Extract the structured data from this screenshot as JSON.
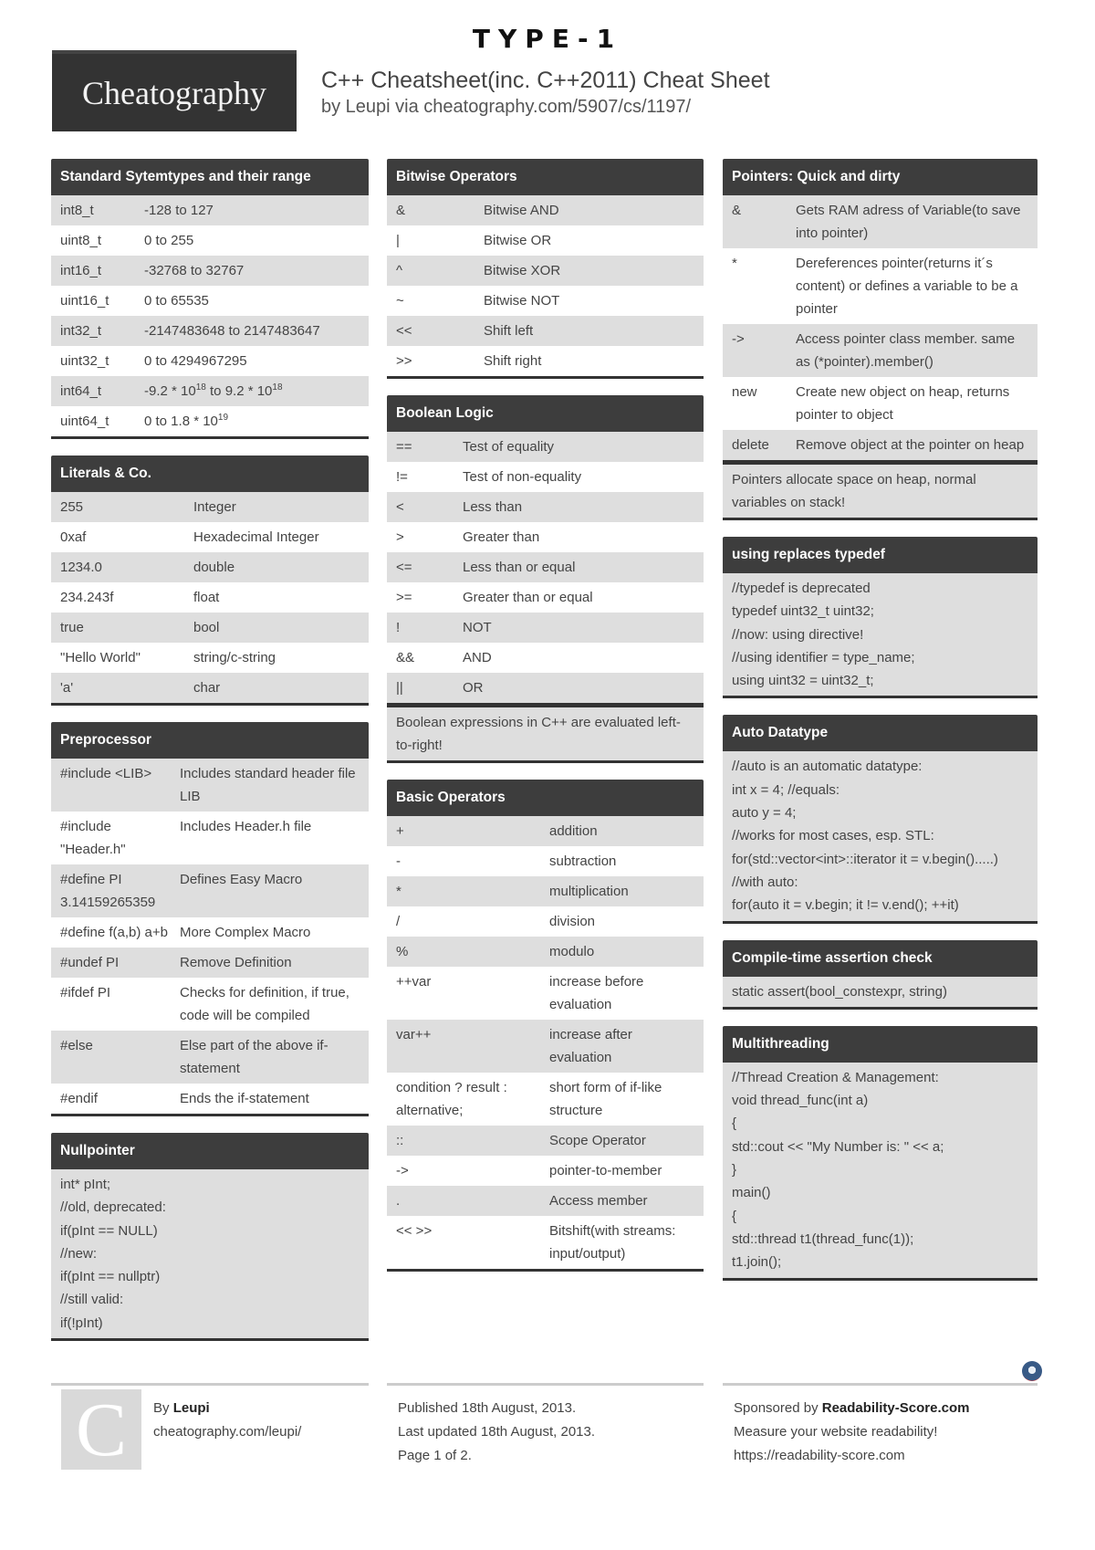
{
  "header": {
    "type_label": "TYPE-1",
    "logo_text": "Cheatography",
    "title": "C++ Cheatsheet(inc. C++2011) Cheat Sheet",
    "byline": "by Leupi via cheatography.com/5907/cs/1197/"
  },
  "sections": {
    "systemtypes": {
      "title": "Standard Sytemtypes and their range",
      "rows": [
        {
          "k": "int8_t",
          "v": "-128 to 127"
        },
        {
          "k": "uint8_t",
          "v": "0 to 255"
        },
        {
          "k": "int16_t",
          "v": "-32768 to 32767"
        },
        {
          "k": "uint16_t",
          "v": "0 to 65535"
        },
        {
          "k": "int32_t",
          "v": "-2147483648 to 2147483647"
        },
        {
          "k": "uint32_t",
          "v": "0 to 4294967295"
        },
        {
          "k": "int64_t",
          "v": "-9.2 * 10",
          "sup1": "18",
          "mid": " to 9.2 * 10",
          "sup2": "18"
        },
        {
          "k": "uint64_t",
          "v": "0 to 1.8 * 10",
          "sup1": "19"
        }
      ]
    },
    "literals": {
      "title": "Literals & Co.",
      "rows": [
        {
          "k": "255",
          "v": "Integer"
        },
        {
          "k": "0xaf",
          "v": "Hexadecimal Integer"
        },
        {
          "k": "1234.0",
          "v": "double"
        },
        {
          "k": "234.243f",
          "v": "float"
        },
        {
          "k": "true",
          "v": "bool"
        },
        {
          "k": "\"Hello World\"",
          "v": "string/c-string"
        },
        {
          "k": "'a'",
          "v": "char"
        }
      ]
    },
    "preprocessor": {
      "title": "Preprocessor",
      "rows": [
        {
          "k": "#include <LIB>",
          "v": "Includes standard header file LIB"
        },
        {
          "k": "#include \"Header.h\"",
          "v": "Includes Header.h file"
        },
        {
          "k": "#define PI 3.14159265359",
          "v": "Defines Easy Macro"
        },
        {
          "k": "#define f(a,b) a+b",
          "v": "More Complex Macro"
        },
        {
          "k": "#undef PI",
          "v": "Remove Definition"
        },
        {
          "k": "#ifdef PI",
          "v": "Checks for definition, if true, code will be compiled"
        },
        {
          "k": "#else",
          "v": "Else part of the above if-statement"
        },
        {
          "k": "#endif",
          "v": "Ends the if-statement"
        }
      ]
    },
    "nullpointer": {
      "title": "Nullpointer",
      "lines": [
        "int* pInt;",
        "//old, deprecated:",
        "if(pInt == NULL)",
        "//new:",
        "if(pInt == nullptr)",
        "//still valid:",
        "if(!pInt)"
      ]
    },
    "bitwise": {
      "title": "Bitwise Operators",
      "rows": [
        {
          "k": "&",
          "v": "Bitwise AND"
        },
        {
          "k": "|",
          "v": "Bitwise OR"
        },
        {
          "k": "^",
          "v": "Bitwise XOR"
        },
        {
          "k": "~",
          "v": "Bitwise NOT"
        },
        {
          "k": "<<",
          "v": "Shift left"
        },
        {
          "k": ">>",
          "v": "Shift right"
        }
      ]
    },
    "boolean": {
      "title": "Boolean Logic",
      "rows": [
        {
          "k": "==",
          "v": "Test of equality"
        },
        {
          "k": "!=",
          "v": "Test of non-equality"
        },
        {
          "k": "<",
          "v": "Less than"
        },
        {
          "k": ">",
          "v": "Greater than"
        },
        {
          "k": "<=",
          "v": "Less than or equal"
        },
        {
          "k": ">=",
          "v": "Greater than or equal"
        },
        {
          "k": "!",
          "v": "NOT"
        },
        {
          "k": "&&",
          "v": "AND"
        },
        {
          "k": "||",
          "v": "OR"
        }
      ],
      "note": "Boolean expressions in C++ are evaluated left-to-right!"
    },
    "basic": {
      "title": "Basic Operators",
      "rows": [
        {
          "k": "+",
          "v": "addition"
        },
        {
          "k": "-",
          "v": "subtraction"
        },
        {
          "k": "*",
          "v": "multiplication"
        },
        {
          "k": "/",
          "v": "division"
        },
        {
          "k": "%",
          "v": "modulo"
        },
        {
          "k": "++var",
          "v": "increase before evaluation"
        },
        {
          "k": "var++",
          "v": "increase after evaluation"
        },
        {
          "k": "condition ? result : alternative;",
          "v": "short form of if-like structure"
        },
        {
          "k": "::",
          "v": "Scope Operator"
        },
        {
          "k": "->",
          "v": "pointer-to-member"
        },
        {
          "k": ".",
          "v": "Access member"
        },
        {
          "k": "<< >>",
          "v": "Bitshift(with streams: input/output)"
        }
      ]
    },
    "pointers": {
      "title": "Pointers: Quick and dirty",
      "rows": [
        {
          "k": "&",
          "v": "Gets RAM adress of Variable(to save into pointer)"
        },
        {
          "k": "*",
          "v": "Dereferences pointer(returns it´s content) or defines a variable to be a pointer"
        },
        {
          "k": "->",
          "v": "Access pointer class member. same as (*pointer).member()"
        },
        {
          "k": "new",
          "v": "Create new object on heap, returns pointer to object"
        },
        {
          "k": "delete",
          "v": "Remove object at the pointer on heap"
        }
      ],
      "note": "Pointers allocate space on heap, normal variables on stack!"
    },
    "using": {
      "title": "using replaces typedef",
      "lines": [
        "//typedef is deprecated",
        "typedef uint32_t uint32;",
        "//now: using directive!",
        "//using identifier = type_name;",
        "using uint32 = uint32_t;"
      ]
    },
    "auto": {
      "title": "Auto Datatype",
      "lines": [
        "//auto is an automatic datatype:",
        "int x = 4; //equals:",
        "auto y = 4;",
        "//works for most cases, esp. STL:",
        "for(std::vector<int>::iterator it = v.begin().....)",
        "//with auto:",
        "for(auto it = v.begin; it != v.end(); ++it)"
      ]
    },
    "static_assert": {
      "title": "Compile-time assertion check",
      "lines": [
        "static assert(bool_constexpr, string)"
      ]
    },
    "multithreading": {
      "title": "Multithreading",
      "lines": [
        "//Thread Creation & Management:",
        "void thread_func(int a)",
        "{",
        "std::cout << \"My Number is: \" << a;",
        "}",
        "main()",
        "{",
        "std::thread t1(thread_func(1));",
        "t1.join();"
      ]
    }
  },
  "footer": {
    "avatar_letter": "C",
    "by_prefix": "By ",
    "author": "Leupi",
    "author_url": "cheatography.com/leupi/",
    "published": "Published 18th August, 2013.",
    "updated": "Last updated 18th August, 2013.",
    "page": "Page 1 of 2.",
    "sponsor_prefix": "Sponsored by ",
    "sponsor_name": "Readability-Score.com",
    "sponsor_tagline": "Measure your website readability!",
    "sponsor_url": "https://readability-score.com"
  }
}
